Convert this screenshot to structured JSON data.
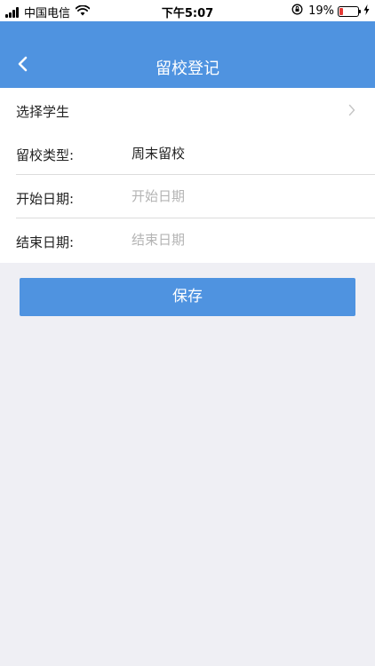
{
  "status_bar": {
    "carrier": "中国电信",
    "time": "下午5:07",
    "battery_percent": "19%",
    "battery_level": 0.19,
    "icons": [
      "signal-icon",
      "wifi-icon",
      "rotation-lock-icon",
      "battery-icon",
      "charging-icon"
    ]
  },
  "nav": {
    "title": "留校登记",
    "back_icon": "chevron-left-icon"
  },
  "form": {
    "student": {
      "label": "选择学生"
    },
    "type": {
      "label": "留校类型:",
      "value": "周末留校"
    },
    "start_date": {
      "label": "开始日期:",
      "placeholder": "开始日期"
    },
    "end_date": {
      "label": "结束日期:",
      "placeholder": "结束日期"
    }
  },
  "save_label": "保存",
  "colors": {
    "accent": "#4f93e0",
    "background": "#efeff4",
    "battery_low": "#e53935"
  }
}
